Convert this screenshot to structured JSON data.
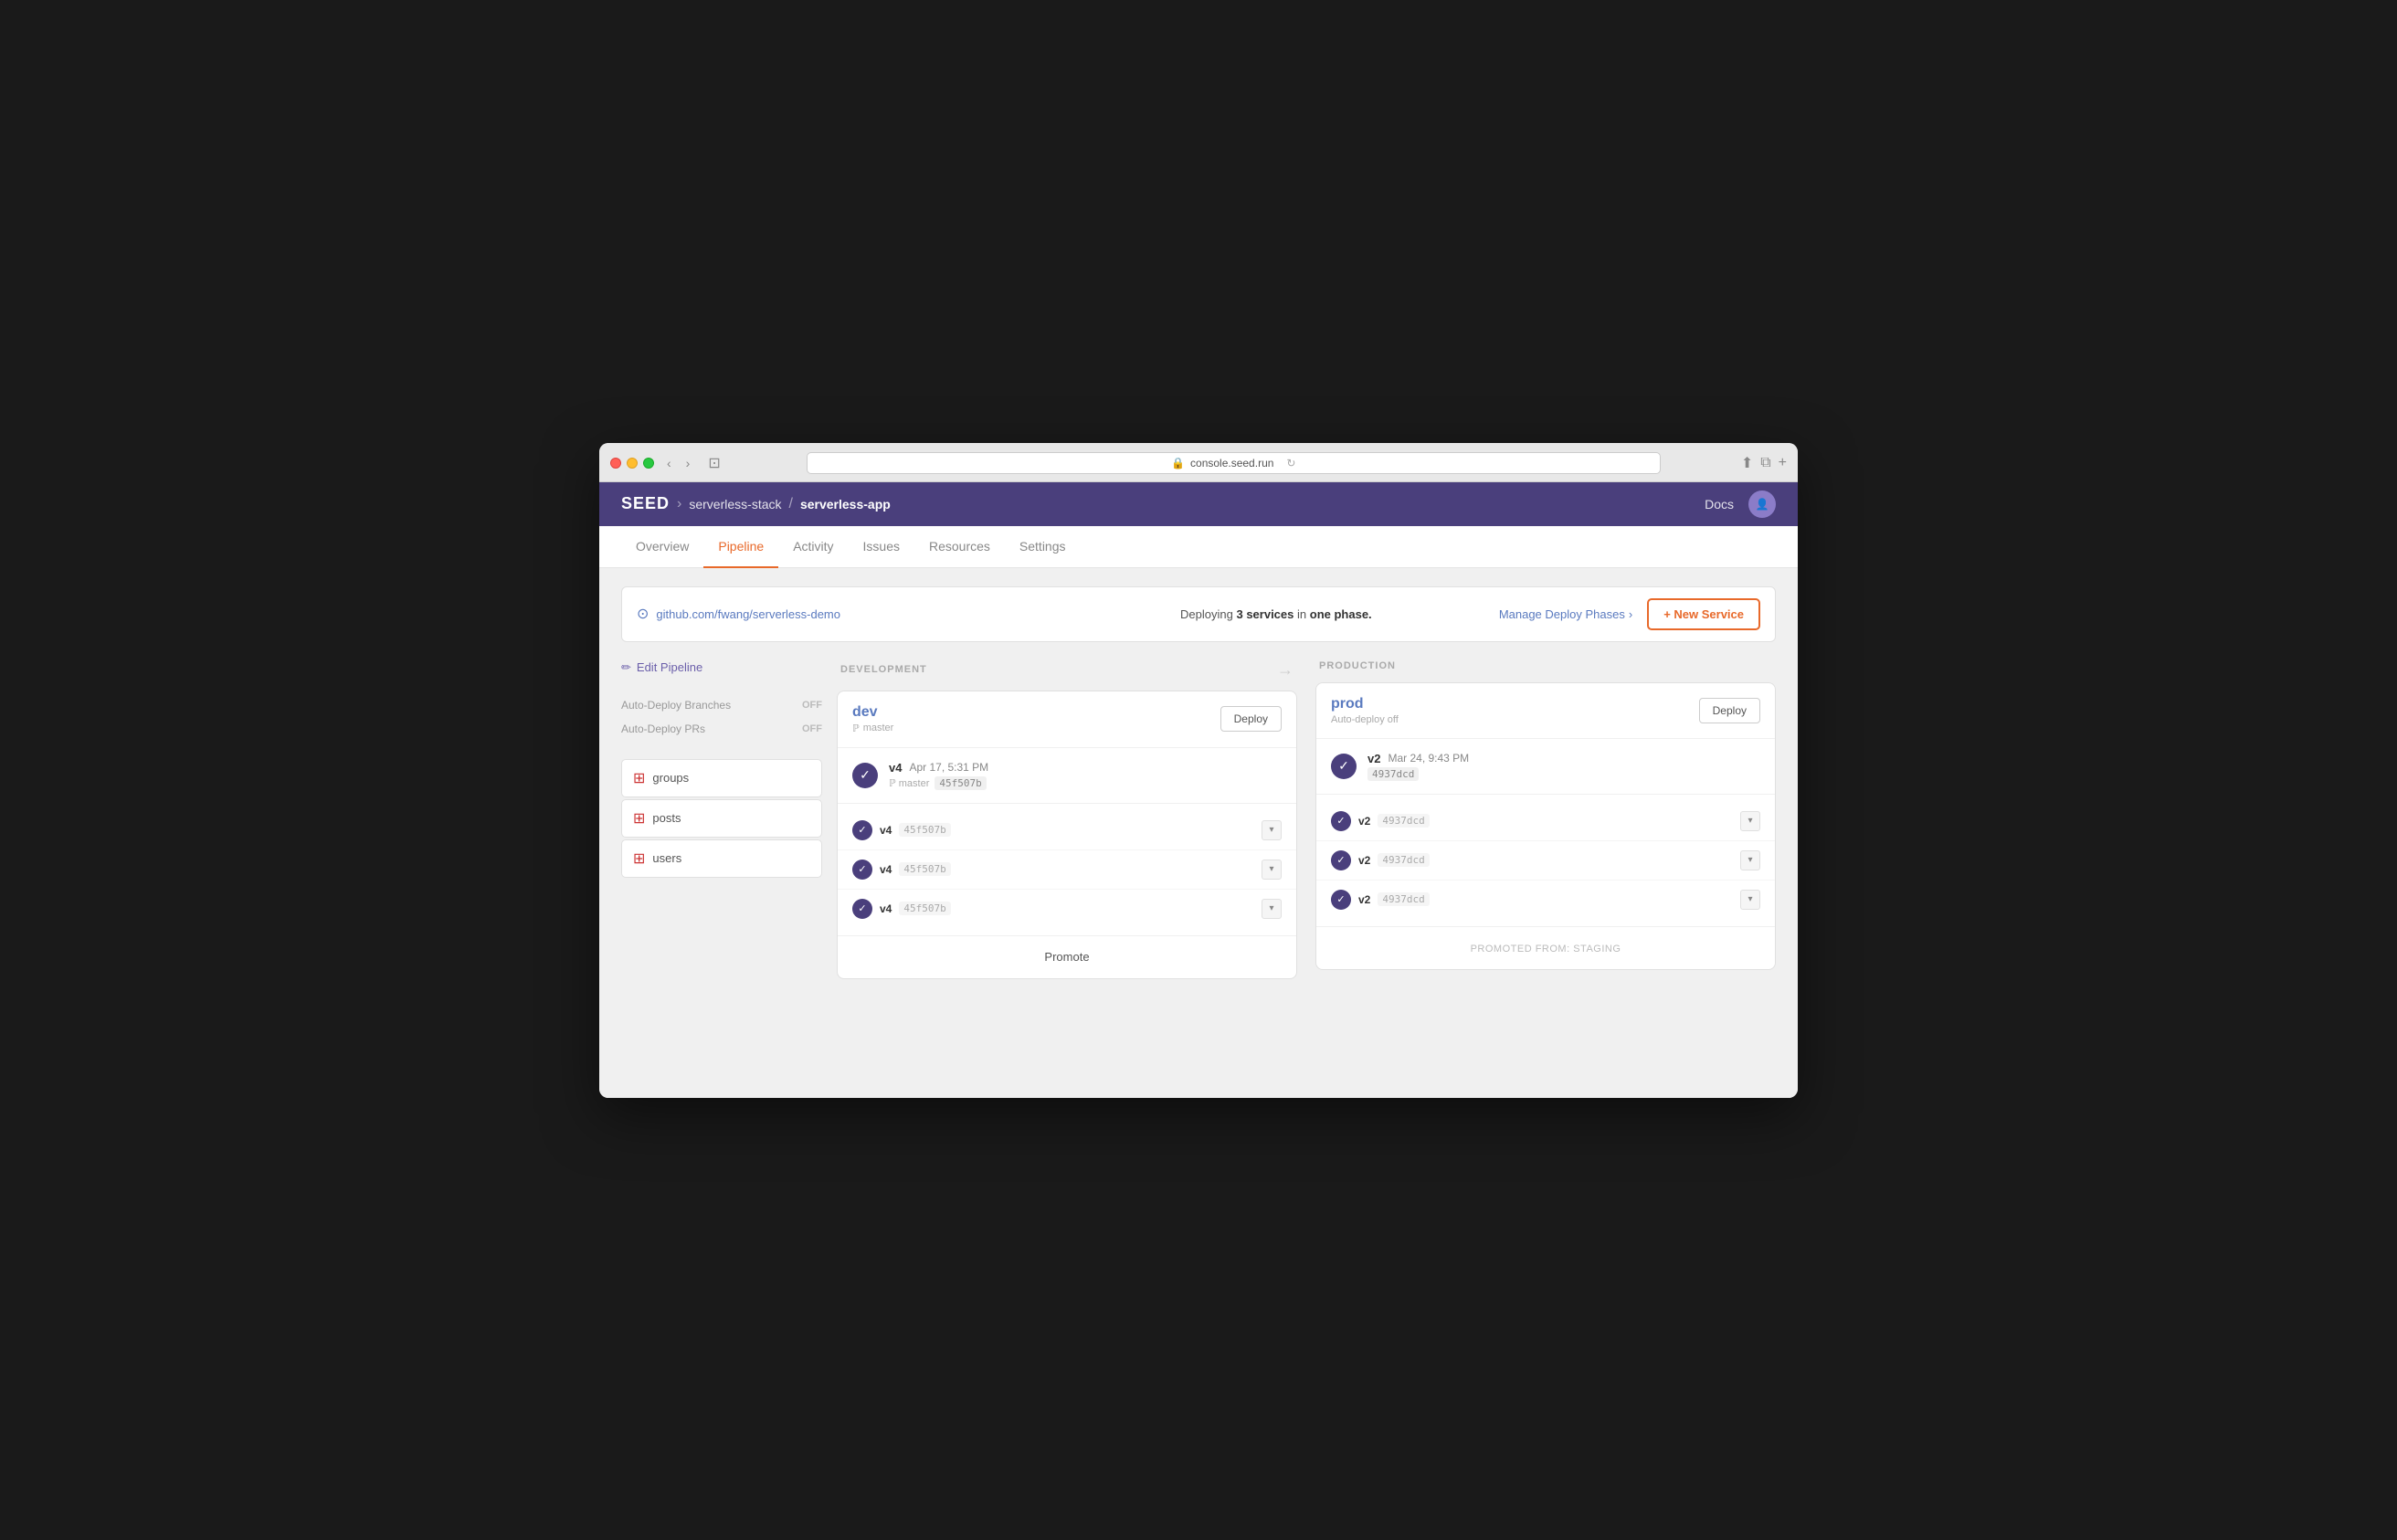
{
  "browser": {
    "url": "console.seed.run"
  },
  "header": {
    "logo": "SEED",
    "breadcrumb1": "serverless-stack",
    "breadcrumb2": "serverless-app",
    "docs": "Docs"
  },
  "nav": {
    "tabs": [
      {
        "label": "Overview",
        "active": false
      },
      {
        "label": "Pipeline",
        "active": true
      },
      {
        "label": "Activity",
        "active": false
      },
      {
        "label": "Issues",
        "active": false
      },
      {
        "label": "Resources",
        "active": false
      },
      {
        "label": "Settings",
        "active": false
      }
    ]
  },
  "infobar": {
    "repo": "github.com/fwang/serverless-demo",
    "deploy_text_before": "Deploying",
    "deploy_bold": "3 services",
    "deploy_text_middle": "in",
    "deploy_bold2": "one phase.",
    "manage_phases": "Manage Deploy Phases",
    "new_service": "+ New Service"
  },
  "sidebar": {
    "edit_pipeline": "Edit Pipeline",
    "settings": [
      {
        "label": "Auto-Deploy Branches",
        "value": "OFF"
      },
      {
        "label": "Auto-Deploy PRs",
        "value": "OFF"
      }
    ],
    "services": [
      {
        "name": "groups"
      },
      {
        "name": "posts"
      },
      {
        "name": "users"
      }
    ]
  },
  "pipeline": {
    "dev_col_title": "DEVELOPMENT",
    "prod_col_title": "PRODUCTION",
    "dev": {
      "name": "dev",
      "branch": "master",
      "branch_prefix": "ℙ",
      "deploy_btn": "Deploy",
      "latest": {
        "version": "v4",
        "date": "Apr 17, 5:31 PM",
        "ref": "ℙ master",
        "commit": "45f507b"
      },
      "services": [
        {
          "version": "v4",
          "commit": "45f507b"
        },
        {
          "version": "v4",
          "commit": "45f507b"
        },
        {
          "version": "v4",
          "commit": "45f507b"
        }
      ],
      "footer": "Promote",
      "footer_type": "promote"
    },
    "prod": {
      "name": "prod",
      "branch": "Auto-deploy off",
      "deploy_btn": "Deploy",
      "latest": {
        "version": "v2",
        "date": "Mar 24, 9:43 PM",
        "commit": "4937dcd"
      },
      "services": [
        {
          "version": "v2",
          "commit": "4937dcd"
        },
        {
          "version": "v2",
          "commit": "4937dcd"
        },
        {
          "version": "v2",
          "commit": "4937dcd"
        }
      ],
      "footer": "PROMOTED FROM: staging",
      "footer_type": "promoted"
    }
  }
}
